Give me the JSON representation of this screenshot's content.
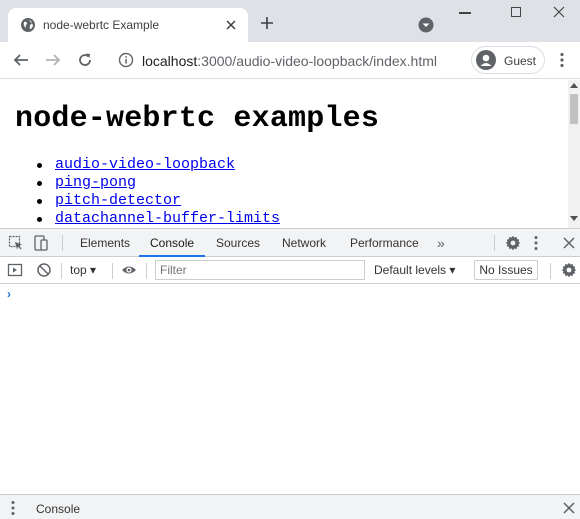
{
  "browser": {
    "tab_title": "node-webrtc Example",
    "url_host": "localhost",
    "url_path": ":3000/audio-video-loopback/index.html",
    "profile_label": "Guest"
  },
  "page": {
    "title": "node-webrtc examples",
    "links": [
      {
        "label": "audio-video-loopback"
      },
      {
        "label": "ping-pong"
      },
      {
        "label": "pitch-detector"
      },
      {
        "label": "datachannel-buffer-limits"
      }
    ]
  },
  "devtools": {
    "tabs": [
      {
        "label": "Elements",
        "active": false
      },
      {
        "label": "Console",
        "active": true
      },
      {
        "label": "Sources",
        "active": false
      },
      {
        "label": "Network",
        "active": false
      },
      {
        "label": "Performance",
        "active": false
      }
    ],
    "context": "top",
    "filter_placeholder": "Filter",
    "levels_label": "Default levels",
    "issues_label": "No Issues",
    "prompt": "›",
    "drawer_title": "Console"
  },
  "colors": {
    "titlebar": "#dee1e6",
    "link": "#0000ee",
    "accent": "#1a73e8"
  }
}
